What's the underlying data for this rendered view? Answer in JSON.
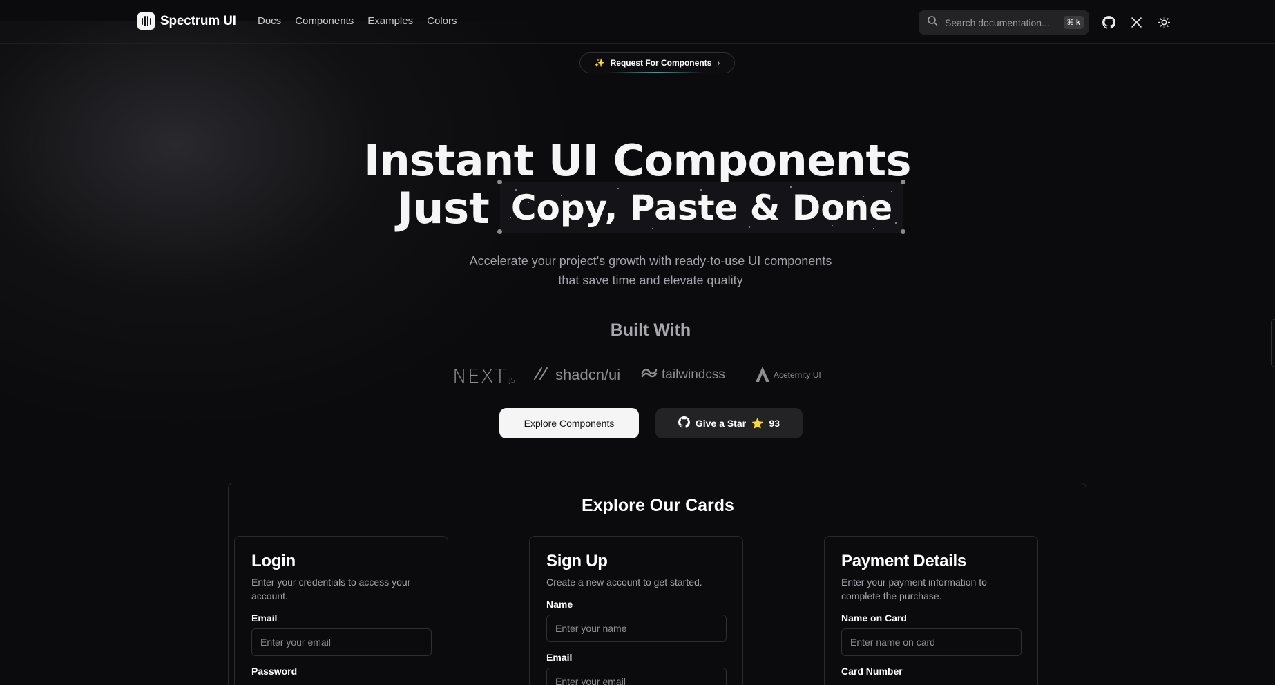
{
  "nav": {
    "brand": "Spectrum UI",
    "links": [
      "Docs",
      "Components",
      "Examples",
      "Colors"
    ],
    "search_placeholder": "Search documentation...",
    "shortcut": "⌘ k",
    "icons": [
      "github-icon",
      "x-twitter-icon",
      "sun-icon"
    ]
  },
  "announcement": {
    "emoji": "✨",
    "label": "Request For Components",
    "chevron": "›"
  },
  "hero": {
    "line1": "Instant UI Components",
    "just": "Just",
    "highlight": "Copy, Paste & Done",
    "subtitle_line1": "Accelerate your project's growth with ready-to-use UI components",
    "subtitle_line2": "that save time and elevate quality"
  },
  "built_with": {
    "title": "Built With",
    "next": "NEXT",
    "next_suffix": ".JS",
    "shadcn": "shadcn/ui",
    "tailwind": "tailwindcss",
    "aceternity": "Aceternity UI"
  },
  "cta": {
    "explore": "Explore Components",
    "star": "Give a Star",
    "star_emoji": "⭐",
    "star_count": "93"
  },
  "cards_section": {
    "title": "Explore Our Cards",
    "login": {
      "title": "Login",
      "desc": "Enter your credentials to access your account.",
      "email_label": "Email",
      "email_placeholder": "Enter your email",
      "password_label": "Password"
    },
    "signup": {
      "title": "Sign Up",
      "desc": "Create a new account to get started.",
      "name_label": "Name",
      "name_placeholder": "Enter your name",
      "email_label": "Email",
      "email_placeholder": "Enter your email"
    },
    "payment": {
      "title": "Payment Details",
      "desc": "Enter your payment information to complete the purchase.",
      "name_label": "Name on Card",
      "name_placeholder": "Enter name on card",
      "card_label": "Card Number"
    }
  },
  "colors": {
    "background": "#0b0b0d",
    "primary_button": "#f5f5f5",
    "secondary_button": "#232326"
  }
}
